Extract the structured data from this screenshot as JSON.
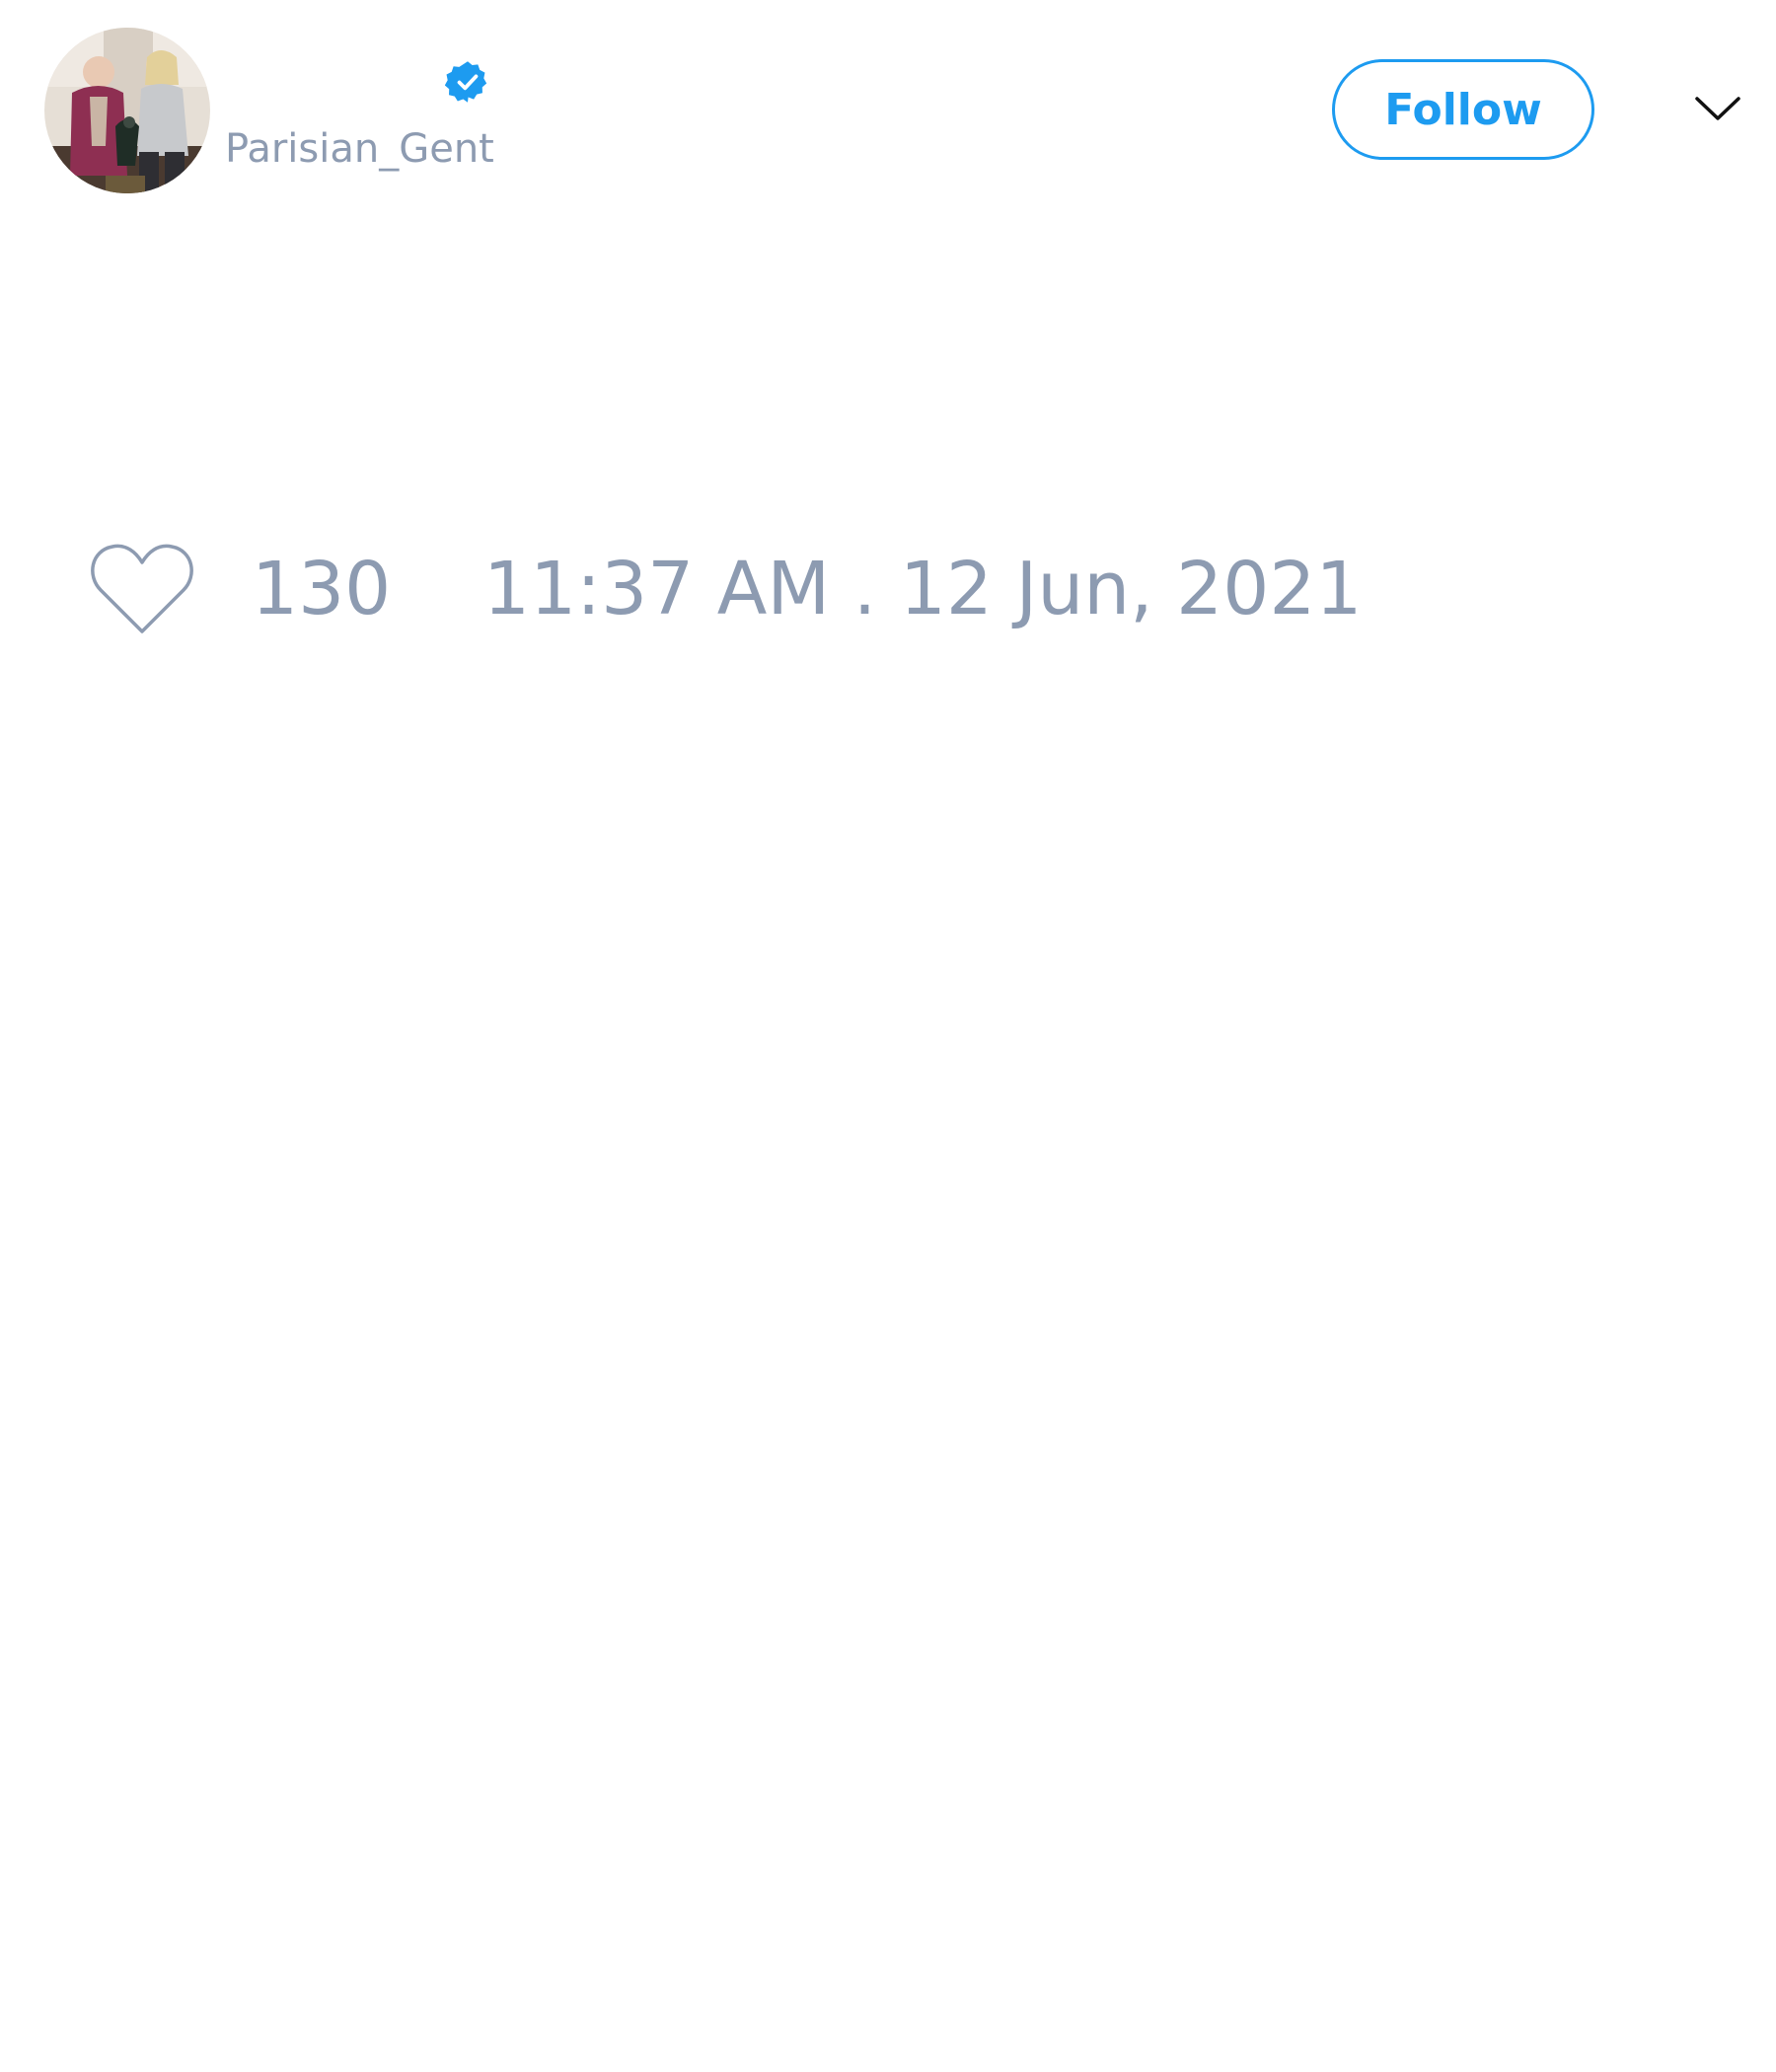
{
  "author": {
    "handle": "Parisian_Gent",
    "verified": true,
    "avatar": "profile-photo-two-people"
  },
  "actions": {
    "follow_label": "Follow",
    "menu_icon": "chevron-down-icon"
  },
  "tweet": {
    "like_icon": "heart-outline-icon",
    "like_count": "130",
    "timestamp": "11:37 AM . 12 Jun, 2021"
  },
  "colors": {
    "accent": "#1d9bf0",
    "muted_text": "#8d9bb1",
    "background": "#ffffff"
  }
}
